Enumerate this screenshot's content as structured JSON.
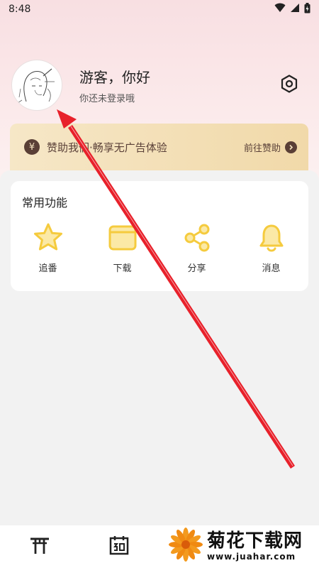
{
  "status_bar": {
    "time": "8:48"
  },
  "profile": {
    "greeting": "游客，你好",
    "subtitle": "你还未登录哦"
  },
  "sponsor": {
    "yen_symbol": "¥",
    "text": "赞助我们·畅享无广告体验",
    "link_label": "前往赞助"
  },
  "features": {
    "title": "常用功能",
    "items": [
      {
        "label": "追番",
        "icon": "star-icon"
      },
      {
        "label": "下载",
        "icon": "folder-icon"
      },
      {
        "label": "分享",
        "icon": "share-icon"
      },
      {
        "label": "消息",
        "icon": "bell-icon"
      }
    ]
  },
  "bottom_nav": {
    "items": [
      {
        "icon": "torii-gate-icon"
      },
      {
        "icon": "calendar-icon"
      }
    ]
  },
  "watermark": {
    "text": "菊花下载网",
    "url": "www.juahar.com"
  },
  "colors": {
    "accent_yellow": "#f5cb3e",
    "annotation_red": "#e8212b",
    "sponsor_brown": "#5a3f36"
  }
}
